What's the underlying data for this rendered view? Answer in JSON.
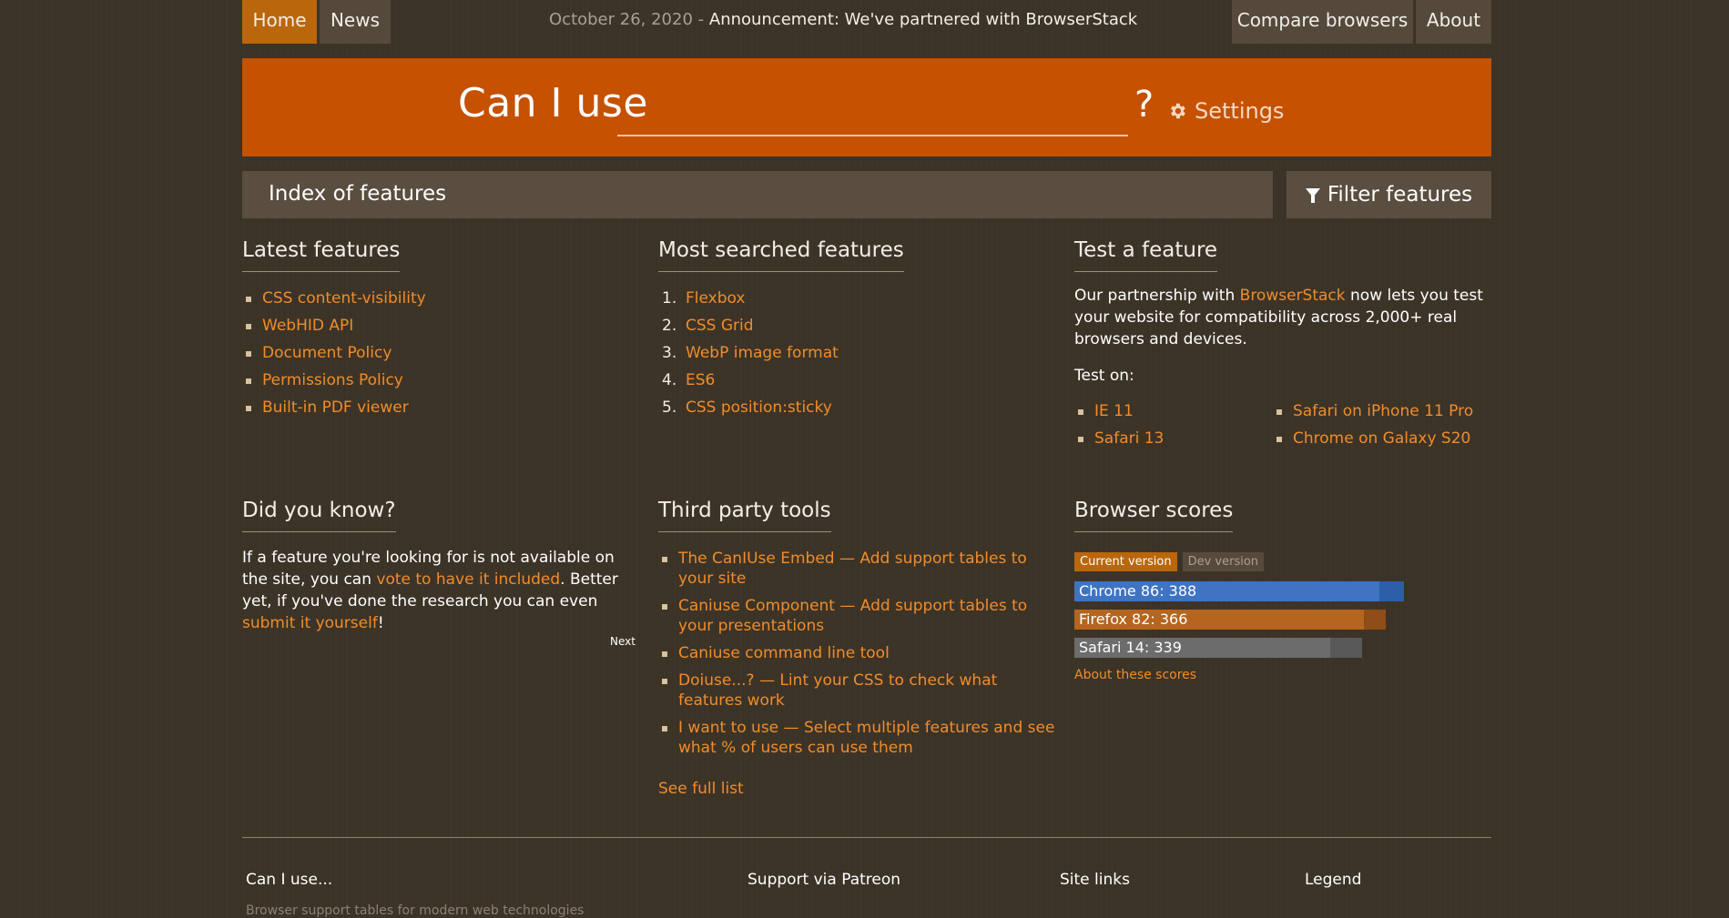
{
  "nav": {
    "home": "Home",
    "news": "News",
    "compare": "Compare browsers",
    "about": "About"
  },
  "announcement": {
    "date": "October 26, 2020",
    "separator": " - ",
    "text": "Announcement: We've partnered with BrowserStack"
  },
  "search": {
    "label": "Can I use",
    "value": "",
    "qmark": "?",
    "settings": "Settings"
  },
  "index": {
    "title": "Index of features",
    "filter": "Filter features"
  },
  "latest": {
    "title": "Latest features",
    "items": [
      "CSS content-visibility",
      "WebHID API",
      "Document Policy",
      "Permissions Policy",
      "Built-in PDF viewer"
    ]
  },
  "most_searched": {
    "title": "Most searched features",
    "items": [
      "Flexbox",
      "CSS Grid",
      "WebP image format",
      "ES6",
      "CSS position:sticky"
    ]
  },
  "test": {
    "title": "Test a feature",
    "text_before": "Our partnership with ",
    "link": "BrowserStack",
    "text_after": " now lets you test your website for compatibility across 2,000+ real browsers and devices.",
    "test_on": "Test on:",
    "left": [
      "IE 11",
      "Safari 13"
    ],
    "right": [
      "Safari on iPhone 11 Pro",
      "Chrome on Galaxy S20"
    ]
  },
  "did_you_know": {
    "title": "Did you know?",
    "t1": "If a feature you're looking for is not available on the site, you can ",
    "l1": "vote to have it included",
    "t2": ". Better yet, if you've done the research you can even ",
    "l2": "submit it yourself",
    "t3": "!",
    "next": "Next"
  },
  "third_party": {
    "title": "Third party tools",
    "items": [
      "The CanIUse Embed — Add support tables to your site",
      "Caniuse Component — Add support tables to your presentations",
      "Caniuse command line tool",
      "Doiuse...? — Lint your CSS to check what features work",
      "I want to use — Select multiple features and see what % of users can use them"
    ],
    "see_full": "See full list"
  },
  "scores": {
    "title": "Browser scores",
    "tab_current": "Current version",
    "tab_dev": "Dev version",
    "bars": [
      {
        "label": "Chrome 86: 388",
        "score": 388,
        "fill_fraction": 0.925,
        "color": "#3f74c2",
        "track": "#2d5ea8"
      },
      {
        "label": "Firefox 82: 366",
        "score": 366,
        "fill_fraction": 0.93,
        "color": "#b5651d",
        "track": "#8f4d17"
      },
      {
        "label": "Safari 14: 339",
        "score": 339,
        "fill_fraction": 0.89,
        "color": "#6c6c6c",
        "track": "#595959"
      }
    ],
    "about": "About these scores"
  },
  "footer": {
    "col1": "Can I use...",
    "col1_sub": "Browser support tables for modern web technologies",
    "col2": "Support via Patreon",
    "col3": "Site links",
    "col4": "Legend"
  },
  "colors": {
    "accent": "#c55101",
    "link": "#f08c2a",
    "home_tab": "#b9660c"
  }
}
